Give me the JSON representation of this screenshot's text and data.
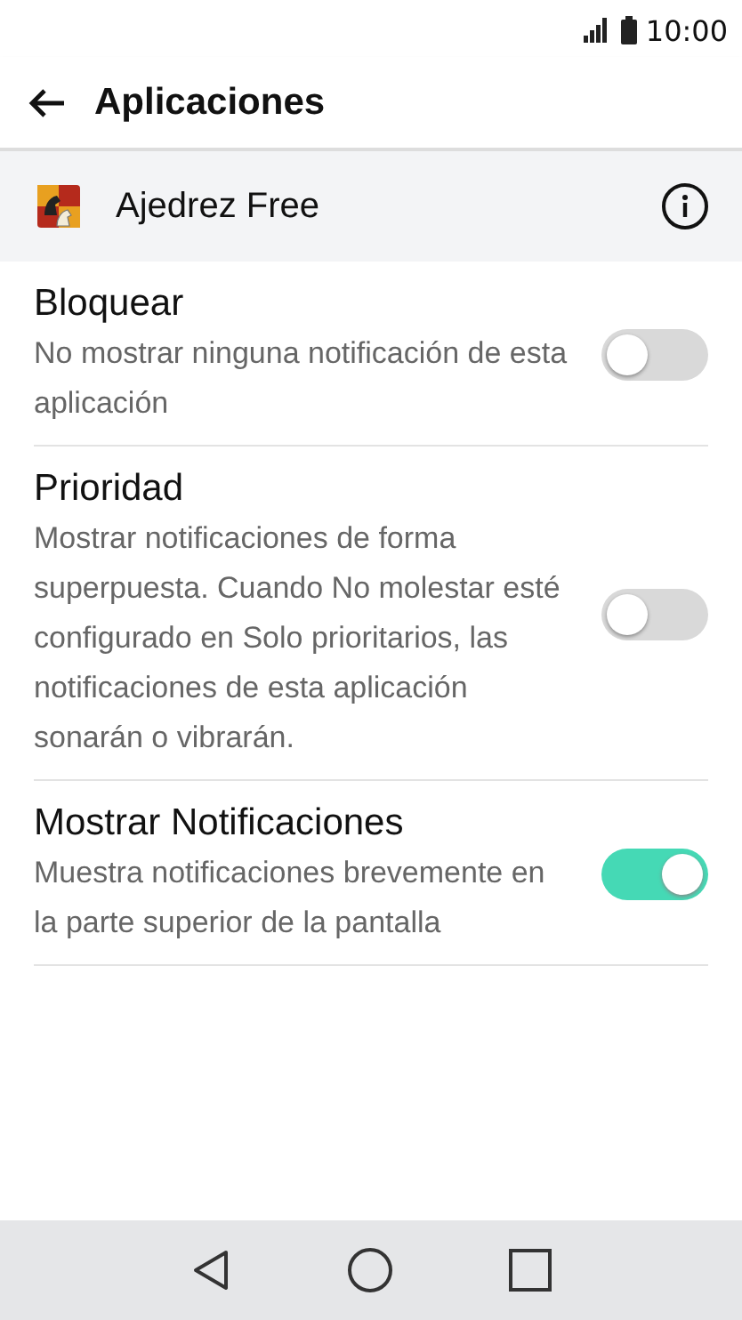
{
  "status_bar": {
    "time": "10:00"
  },
  "header": {
    "title": "Aplicaciones"
  },
  "app": {
    "name": "Ajedrez Free"
  },
  "settings": [
    {
      "title": "Bloquear",
      "description": "No mostrar ninguna notificación de esta aplicación",
      "on": false
    },
    {
      "title": "Prioridad",
      "description": "Mostrar notificaciones de forma superpuesta. Cuando No molestar esté configurado en Solo prioritarios, las notificaciones de esta aplicación sonarán o vibrarán.",
      "on": false
    },
    {
      "title": "Mostrar Notificaciones",
      "description": "Muestra notificaciones brevemente en la parte superior de la pantalla",
      "on": true
    }
  ]
}
